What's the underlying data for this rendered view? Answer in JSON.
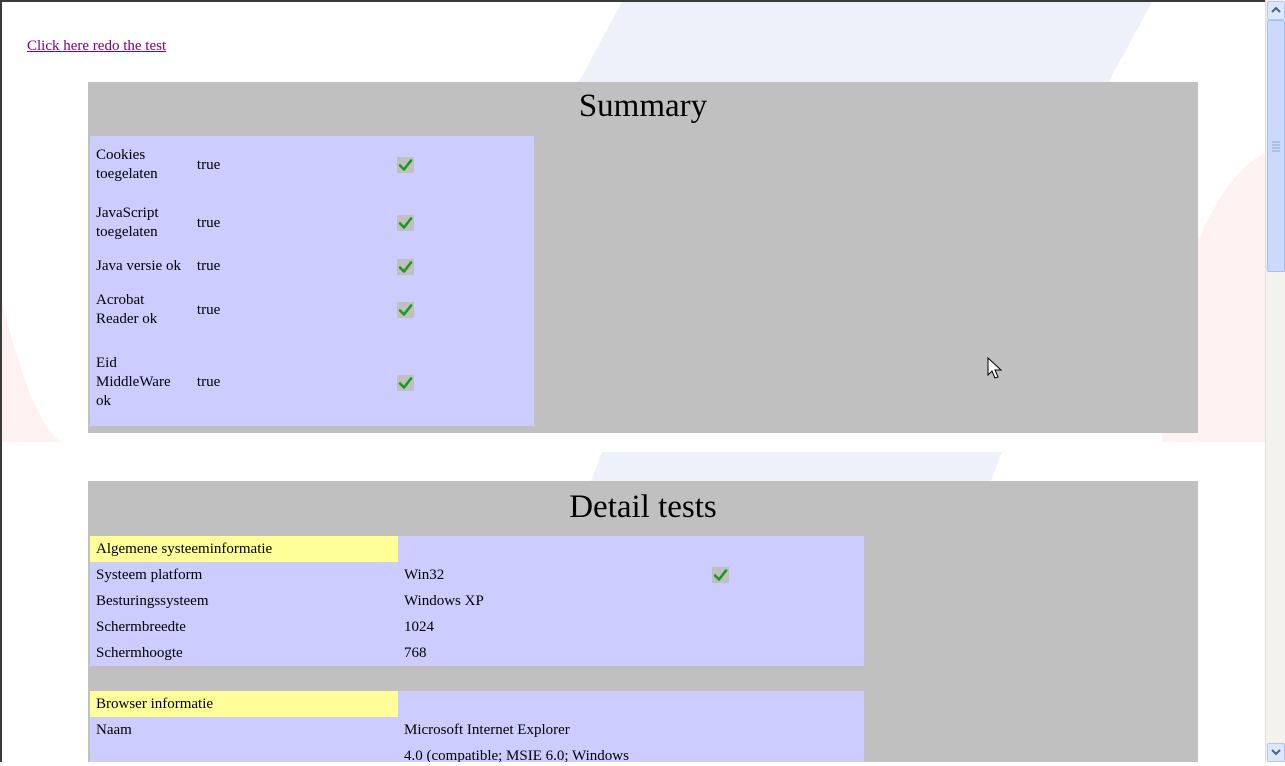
{
  "link": {
    "redo_text": "Click here redo the test"
  },
  "summary": {
    "title": "Summary",
    "rows": [
      {
        "label": "Cookies toegelaten",
        "value": "true",
        "status": "check-icon"
      },
      {
        "label": "JavaScript toegelaten",
        "value": "true",
        "status": "check-icon"
      },
      {
        "label": "Java versie ok",
        "value": "true",
        "status": "check-icon"
      },
      {
        "label": "Acrobat Reader ok",
        "value": "true",
        "status": "check-icon"
      },
      {
        "label": "Eid MiddleWare ok",
        "value": "true",
        "status": "check-icon"
      }
    ]
  },
  "detail": {
    "title": "Detail tests",
    "sections": [
      {
        "header": "Algemene systeeminformatie",
        "rows": [
          {
            "label": "Systeem platform",
            "value": "Win32",
            "check": true
          },
          {
            "label": "Besturingssysteem",
            "value": "Windows XP"
          },
          {
            "label": "Schermbreedte",
            "value": "1024"
          },
          {
            "label": "Schermhoogte",
            "value": "768"
          }
        ]
      },
      {
        "header": "Browser informatie",
        "rows": [
          {
            "label": "Naam",
            "value": "Microsoft Internet Explorer"
          },
          {
            "label": "",
            "value": "4.0 (compatible; MSIE 6.0; Windows"
          }
        ]
      }
    ]
  },
  "colors": {
    "panel_bg": "#c0c0c0",
    "table_bg": "#ccccff",
    "section_header_bg": "#ffff99",
    "link_visited": "#800080",
    "check_green": "#1a9a1a"
  }
}
